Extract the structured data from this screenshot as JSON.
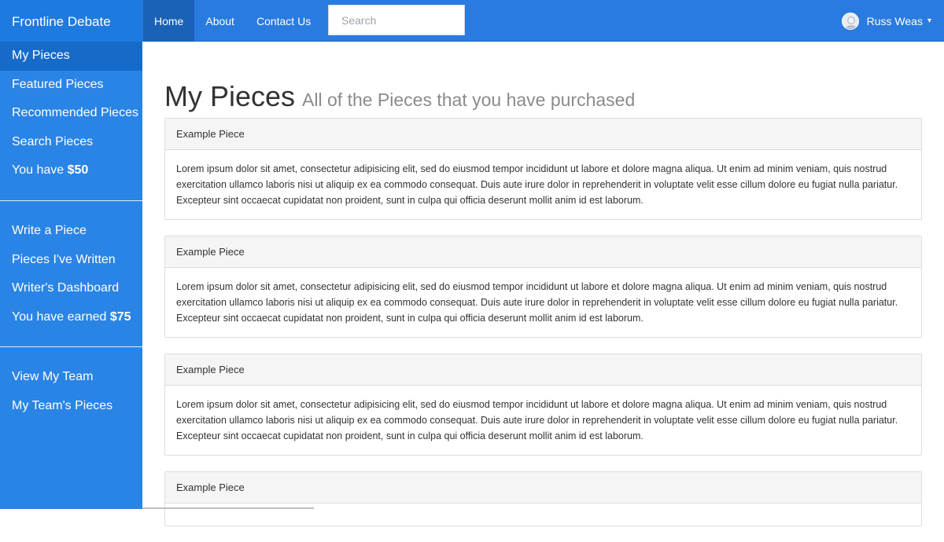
{
  "brand": "Frontline Debate",
  "nav": {
    "items": [
      {
        "label": "Home"
      },
      {
        "label": "About"
      },
      {
        "label": "Contact Us"
      }
    ],
    "search_placeholder": "Search"
  },
  "user": {
    "name": "Russ Weas",
    "caret": "▾"
  },
  "sidebar": {
    "group1": [
      {
        "label": "My Pieces"
      },
      {
        "label": "Featured Pieces"
      },
      {
        "label": "Recommended Pieces"
      },
      {
        "label": "Search Pieces"
      }
    ],
    "balance_prefix": "You have ",
    "balance_amount": "$50",
    "group2": [
      {
        "label": "Write a Piece"
      },
      {
        "label": "Pieces I've Written"
      },
      {
        "label": "Writer's Dashboard"
      }
    ],
    "earned_prefix": "You have earned ",
    "earned_amount": "$75",
    "group3": [
      {
        "label": "View My Team"
      },
      {
        "label": "My Team's Pieces"
      }
    ]
  },
  "main": {
    "title": "My Pieces",
    "subtitle": "All of the Pieces that you have purchased",
    "pieces": [
      {
        "heading": "Example Piece",
        "body": "Lorem ipsum dolor sit amet, consectetur adipisicing elit, sed do eiusmod tempor incididunt ut labore et dolore magna aliqua. Ut enim ad minim veniam, quis nostrud exercitation ullamco laboris nisi ut aliquip ex ea commodo consequat. Duis aute irure dolor in reprehenderit in voluptate velit esse cillum dolore eu fugiat nulla pariatur. Excepteur sint occaecat cupidatat non proident, sunt in culpa qui officia deserunt mollit anim id est laborum."
      },
      {
        "heading": "Example Piece",
        "body": "Lorem ipsum dolor sit amet, consectetur adipisicing elit, sed do eiusmod tempor incididunt ut labore et dolore magna aliqua. Ut enim ad minim veniam, quis nostrud exercitation ullamco laboris nisi ut aliquip ex ea commodo consequat. Duis aute irure dolor in reprehenderit in voluptate velit esse cillum dolore eu fugiat nulla pariatur. Excepteur sint occaecat cupidatat non proident, sunt in culpa qui officia deserunt mollit anim id est laborum."
      },
      {
        "heading": "Example Piece",
        "body": "Lorem ipsum dolor sit amet, consectetur adipisicing elit, sed do eiusmod tempor incididunt ut labore et dolore magna aliqua. Ut enim ad minim veniam, quis nostrud exercitation ullamco laboris nisi ut aliquip ex ea commodo consequat. Duis aute irure dolor in reprehenderit in voluptate velit esse cillum dolore eu fugiat nulla pariatur. Excepteur sint occaecat cupidatat non proident, sunt in culpa qui officia deserunt mollit anim id est laborum."
      },
      {
        "heading": "Example Piece",
        "body": ""
      }
    ]
  },
  "colors": {
    "nav_bg": "#2a7be0",
    "sidebar_bg": "#2a84e5",
    "sidebar_active": "#176bc8",
    "nav_active": "#1a62b8"
  }
}
